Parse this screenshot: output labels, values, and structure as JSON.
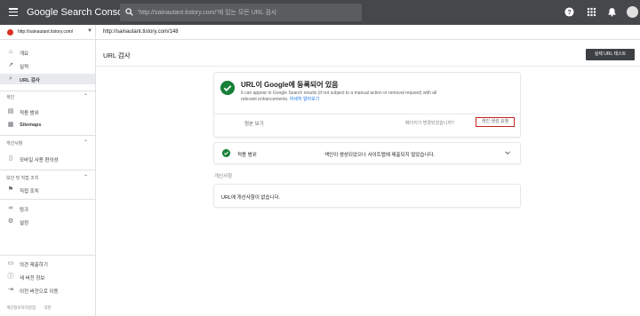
{
  "topbar": {
    "logo": "Google Search Console",
    "search_placeholder": "'http://sainautant.tistory.com/'에 있는 모든 URL 검사"
  },
  "sidebar": {
    "property": "http://sainautant.tistory.com/",
    "items": [
      {
        "label": "개요",
        "icon": "home-icon"
      },
      {
        "label": "실적",
        "icon": "trending-icon"
      },
      {
        "label": "URL 검사",
        "icon": "search-icon"
      }
    ],
    "index_section": "색인",
    "index_items": [
      {
        "label": "적용 범위",
        "icon": "coverage-icon"
      },
      {
        "label": "Sitemaps",
        "icon": "sitemap-icon"
      }
    ],
    "enh_section": "개선사항",
    "enh_items": [
      {
        "label": "모바일 사용 편의성",
        "icon": "mobile-icon"
      }
    ],
    "security_section": "보안 및 직접 조치",
    "security_items": [
      {
        "label": "직접 조치",
        "icon": "flag-icon"
      }
    ],
    "other_items": [
      {
        "label": "링크",
        "icon": "link-icon"
      },
      {
        "label": "설정",
        "icon": "settings-icon"
      }
    ],
    "bottom_items": [
      {
        "label": "의견 제출하기",
        "icon": "feedback-icon"
      },
      {
        "label": "새 버전 정보",
        "icon": "info-icon"
      },
      {
        "label": "이전 버전으로 이동",
        "icon": "exit-icon"
      }
    ],
    "footer": [
      "개인정보처리방침",
      "약관"
    ]
  },
  "urlbar": {
    "url": "http://sainautant.tistory.com/148"
  },
  "main": {
    "title": "URL 검사",
    "live_test_label": "실제 URL 테스트",
    "status": {
      "title": "URL이 Google에 등록되어 있음",
      "desc": "It can appear in Google Search results (if not subject to a manual action or removal request) with all relevant enhancements.",
      "learn_more": "자세히 알아보기",
      "view_page": "원본 보기",
      "changed_q": "페이지가 변경되었습니까?",
      "request_indexing": "색인 생성 요청"
    },
    "coverage": {
      "label": "적용 범위",
      "status": "색인이 생성되었으나 사이트맵에 제출되지 않았습니다."
    },
    "enhancements": {
      "header": "개선사항",
      "text": "URL에 개선사항이 없습니다."
    }
  },
  "colors": {
    "topbar": "#45474a",
    "success": "#188038",
    "highlight_border": "#c5221f"
  }
}
